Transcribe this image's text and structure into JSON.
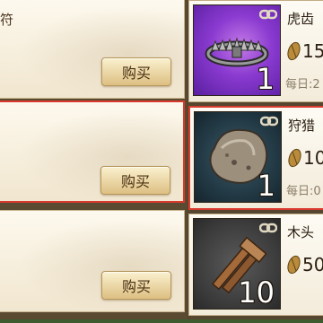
{
  "list_panels": [
    {
      "title": "符",
      "buy_label": "购买",
      "selected": false
    },
    {
      "title": "",
      "buy_label": "购买",
      "selected": true
    },
    {
      "title": "",
      "buy_label": "购买",
      "selected": false
    }
  ],
  "items": [
    {
      "name": "虎齿",
      "quantity": "1",
      "price": "15",
      "daily_limit": "每日:2",
      "icon": "bear-trap",
      "selected": false
    },
    {
      "name": "狩猎",
      "quantity": "1",
      "price": "10",
      "daily_limit": "每日:0",
      "icon": "stone",
      "selected": true
    },
    {
      "name": "木头",
      "quantity": "10",
      "price": "50",
      "daily_limit": "",
      "icon": "wood-planks",
      "selected": false
    }
  ],
  "colors": {
    "selection_border": "#d93a2e",
    "rare_bg": "#7a2fc4"
  }
}
